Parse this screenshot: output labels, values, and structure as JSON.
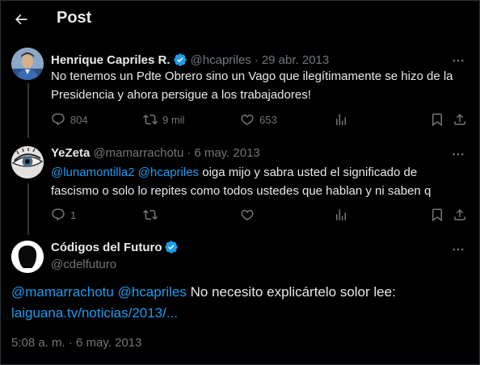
{
  "header": {
    "title": "Post",
    "back_icon": "arrow-left-icon"
  },
  "tweets": [
    {
      "name": "Henrique Capriles R.",
      "handle": "@hcapriles",
      "date": "29 abr. 2013",
      "text": "No tenemos un Pdte Obrero sino un Vago que ilegítimamente se hizo de la Presidencia y ahora persigue a los trabajadores!",
      "replies": "804",
      "retweets": "9 mil",
      "likes": "653",
      "verified": true
    },
    {
      "name": "YeZeta",
      "handle": "@mamarrachotu",
      "date": "6 may. 2013",
      "mention1": "@lunamontilla2",
      "mention2": "@hcapriles",
      "text": " oiga mijo y sabra usted el significado de fascismo o solo lo repites como todos ustedes que hablan y ni saben q",
      "replies": "1",
      "verified": false
    }
  ],
  "main_tweet": {
    "name": "Códigos del Futuro",
    "handle": "@cdelfuturo",
    "mention1": "@mamarrachotu",
    "mention2": "@hcapriles",
    "text": " No necesito explicártelo solor lee:",
    "link": "laiguana.tv/noticias/2013/...",
    "timestamp": "5:08 a. m. · 6 may. 2013",
    "verified": true
  },
  "colors": {
    "background": "#000000",
    "accent": "#1d9bf0",
    "muted": "#71767b",
    "text": "#e7e9ea"
  }
}
